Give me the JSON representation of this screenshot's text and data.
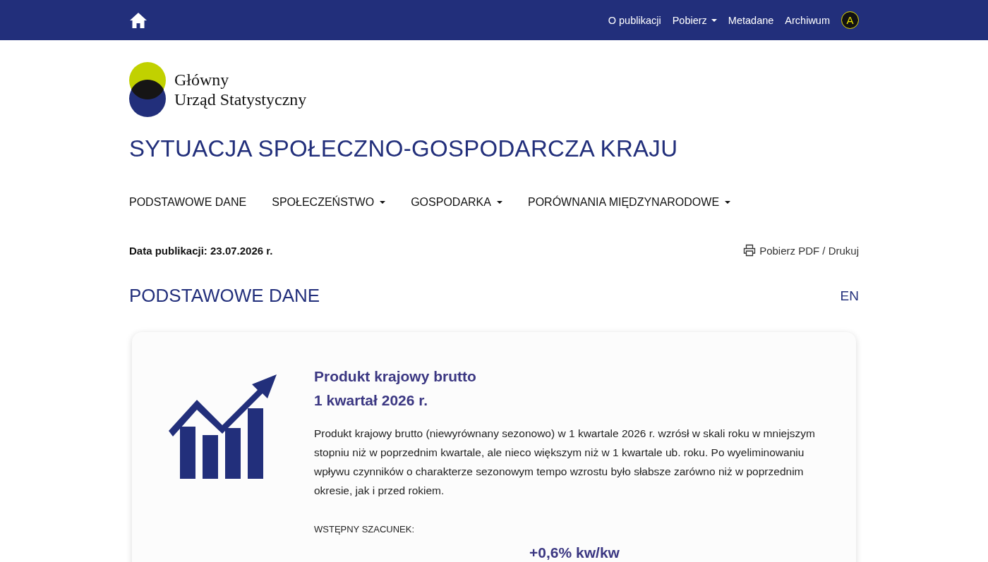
{
  "top_bar": {
    "links": [
      {
        "label": "O publikacji",
        "dropdown": false
      },
      {
        "label": "Pobierz",
        "dropdown": true
      },
      {
        "label": "Metadane",
        "dropdown": false
      },
      {
        "label": "Archiwum",
        "dropdown": false
      }
    ],
    "accessibility": "A"
  },
  "logo": {
    "lines": [
      "Główny",
      "Urząd Statystyczny"
    ]
  },
  "title": "SYTUACJA SPOŁECZNO-GOSPODARCZA KRAJU",
  "main_nav": [
    {
      "label": "PODSTAWOWE DANE",
      "dropdown": false
    },
    {
      "label": "SPOŁECZEŃSTWO",
      "dropdown": true
    },
    {
      "label": "GOSPODARKA",
      "dropdown": true
    },
    {
      "label": "PORÓWNANIA MIĘDZYNARODOWE",
      "dropdown": true
    }
  ],
  "publication_date": "Data publikacji: 23.07.2026 r.",
  "download_link": "Pobierz PDF / Drukuj",
  "section": {
    "heading": "PODSTAWOWE DANE",
    "language": "EN"
  },
  "card": {
    "title": "Produkt krajowy brutto",
    "period": "1 kwartał 2026 r.",
    "description": "Produkt krajowy brutto (niewyrównany sezonowo) w 1 kwartale 2026 r. wzrósł w skali roku w mniejszym stopniu niż w poprzednim kwartale, ale nieco większym niż w 1 kwartale ub. roku. Po wyeliminowaniu wpływu czynników o charakterze sezonowym tempo wzrostu było słabsze zarówno niż w poprzednim okresie, jak i przed rokiem.",
    "estimate_label": "WSTĘPNY SZACUNEK:",
    "value": "+0,6% kw/kw"
  }
}
